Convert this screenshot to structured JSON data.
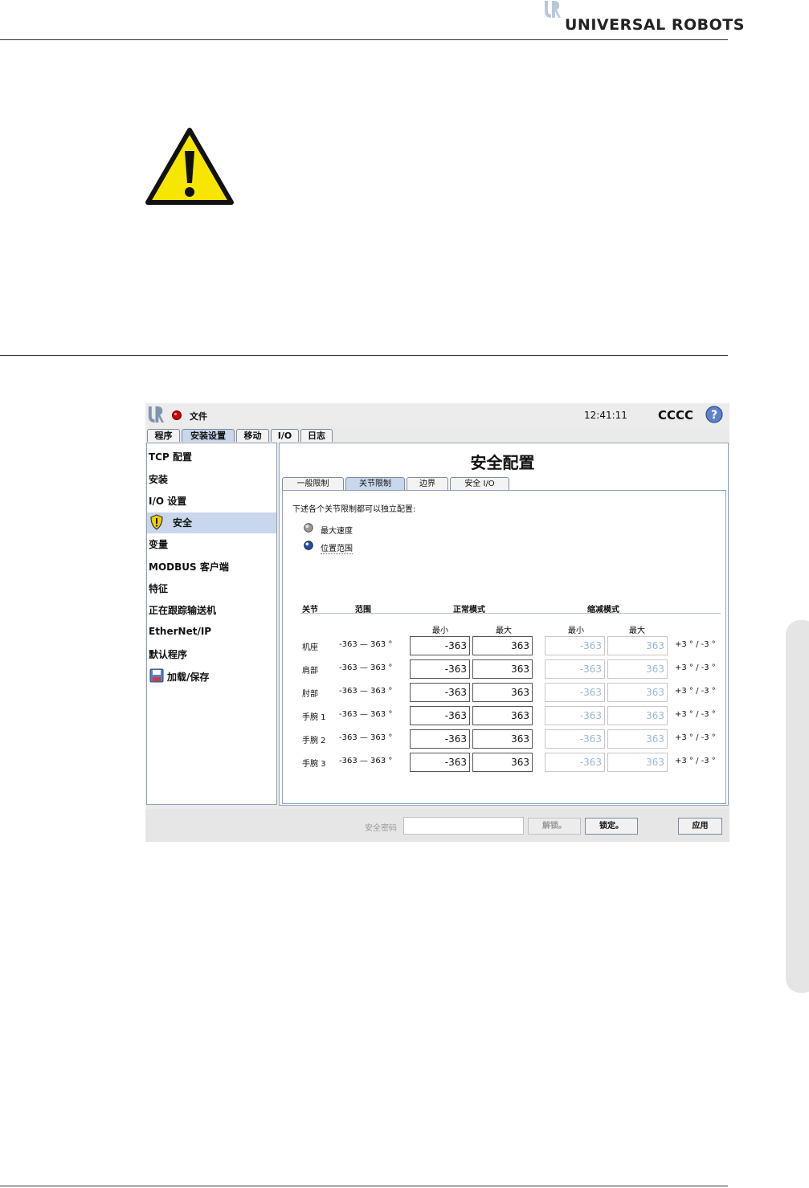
{
  "brand": {
    "name": "UNIVERSAL ROBOTS",
    "logo_icon": "ur-logo-icon"
  },
  "warning": {
    "icon": "warning-triangle-icon",
    "color": "#f7e600"
  },
  "app": {
    "logo_icon": "ur-logo-icon",
    "status_icon": "status-led-icon",
    "file_menu": "文件",
    "clock": "12:41:11",
    "robot_name": "CCCC",
    "help_icon": "help-icon",
    "tabs": [
      {
        "label": "程序"
      },
      {
        "label": "安装设置"
      },
      {
        "label": "移动"
      },
      {
        "label": "I/O"
      },
      {
        "label": "日志"
      }
    ],
    "active_tab": "安装设置"
  },
  "sidebar": {
    "items": [
      {
        "label": "TCP 配置"
      },
      {
        "label": "安装"
      },
      {
        "label": "I/O 设置"
      },
      {
        "label": "安全",
        "icon": "shield-warning-icon",
        "selected": true
      },
      {
        "label": "变量"
      },
      {
        "label": "MODBUS 客户端"
      },
      {
        "label": "特征"
      },
      {
        "label": "正在跟踪输送机"
      },
      {
        "label": "EtherNet/IP"
      },
      {
        "label": "默认程序"
      },
      {
        "label": "加载/保存",
        "icon": "floppy-disk-icon"
      }
    ]
  },
  "main": {
    "title": "安全配置",
    "subtabs": [
      {
        "label": "一般限制"
      },
      {
        "label": "关节限制"
      },
      {
        "label": "边界"
      },
      {
        "label": "安全 I/O"
      }
    ],
    "active_subtab": "关节限制",
    "description": "下述各个关节限制都可以独立配置:",
    "options": [
      {
        "label": "最大速度",
        "selected": false
      },
      {
        "label": "位置范围",
        "selected": true
      }
    ],
    "table": {
      "headers": {
        "joint": "关节",
        "range": "范围",
        "normal": "正常模式",
        "reduced": "缩减模式"
      },
      "subheaders": {
        "min": "最小",
        "max": "最大"
      },
      "rows": [
        {
          "joint": "机座",
          "range": "-363 — 363 °",
          "normal_min": "-363",
          "normal_max": "363",
          "reduced_min": "-363",
          "reduced_max": "363",
          "tolerance": "+3 ° / -3 °"
        },
        {
          "joint": "肩部",
          "range": "-363 — 363 °",
          "normal_min": "-363",
          "normal_max": "363",
          "reduced_min": "-363",
          "reduced_max": "363",
          "tolerance": "+3 ° / -3 °"
        },
        {
          "joint": "肘部",
          "range": "-363 — 363 °",
          "normal_min": "-363",
          "normal_max": "363",
          "reduced_min": "-363",
          "reduced_max": "363",
          "tolerance": "+3 ° / -3 °"
        },
        {
          "joint": "手腕 1",
          "range": "-363 — 363 °",
          "normal_min": "-363",
          "normal_max": "363",
          "reduced_min": "-363",
          "reduced_max": "363",
          "tolerance": "+3 ° / -3 °"
        },
        {
          "joint": "手腕 2",
          "range": "-363 — 363 °",
          "normal_min": "-363",
          "normal_max": "363",
          "reduced_min": "-363",
          "reduced_max": "363",
          "tolerance": "+3 ° / -3 °"
        },
        {
          "joint": "手腕 3",
          "range": "-363 — 363 °",
          "normal_min": "-363",
          "normal_max": "363",
          "reduced_min": "-363",
          "reduced_max": "363",
          "tolerance": "+3 ° / -3 °"
        }
      ]
    }
  },
  "footer": {
    "password_label": "安全密码",
    "password_value": "",
    "unlock": "解锁。",
    "lock": "锁定。",
    "apply": "应用"
  }
}
